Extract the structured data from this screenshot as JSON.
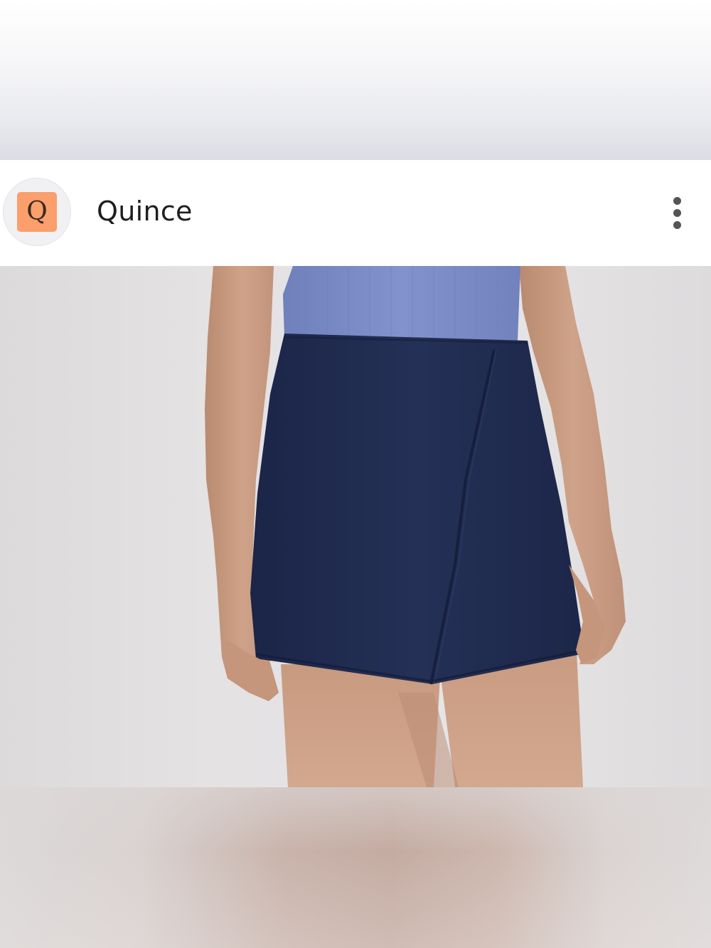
{
  "header": {
    "avatar_letter": "Q",
    "brand_name": "Quince"
  },
  "colors": {
    "avatar_tile": "#fb9f6c",
    "skirt": "#1f2a50",
    "top": "#7c8dc6",
    "skin": "#c99c82"
  },
  "icons": {
    "more": "more-vertical-icon"
  },
  "photo": {
    "subject": "product-photo"
  }
}
